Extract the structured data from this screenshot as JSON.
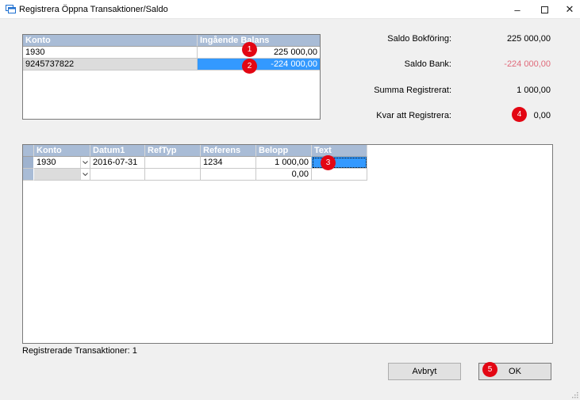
{
  "window": {
    "title": "Registrera Öppna Transaktioner/Saldo",
    "minimize_glyph": "–",
    "close_glyph": "✕"
  },
  "balance_grid": {
    "columns": [
      "Konto",
      "Ingående Balans"
    ],
    "rows": [
      {
        "konto": "1930",
        "balans": "225 000,00"
      },
      {
        "konto": "9245737822",
        "balans": "-224 000,00"
      }
    ]
  },
  "summary": {
    "saldo_bokforing_label": "Saldo Bokföring:",
    "saldo_bokforing_value": "225 000,00",
    "saldo_bank_label": "Saldo Bank:",
    "saldo_bank_value": "-224 000,00",
    "summa_label": "Summa Registrerat:",
    "summa_value": "1 000,00",
    "kvar_label": "Kvar att Registrera:",
    "kvar_value": "0,00"
  },
  "transactions_grid": {
    "columns": [
      "Konto",
      "Datum1",
      "RefTyp",
      "Referens",
      "Belopp",
      "Text"
    ],
    "rows": [
      {
        "konto": "1930",
        "datum": "2016-07-31",
        "reftyp": "",
        "referens": "1234",
        "belopp": "1 000,00",
        "text": ""
      },
      {
        "konto": "",
        "datum": "",
        "reftyp": "",
        "referens": "",
        "belopp": "0,00",
        "text": ""
      }
    ]
  },
  "status": {
    "text": "Registrerade Transaktioner: 1"
  },
  "buttons": {
    "cancel": "Avbryt",
    "ok": "OK"
  },
  "markers": [
    "1",
    "2",
    "3",
    "4",
    "5"
  ],
  "colors": {
    "header_bg": "#a9bcd6",
    "selection": "#3399ff",
    "negative": "#e06a7a",
    "marker": "#e30613"
  },
  "icons": {
    "combo": "chevron-down-icon",
    "app": "window-app-icon"
  }
}
